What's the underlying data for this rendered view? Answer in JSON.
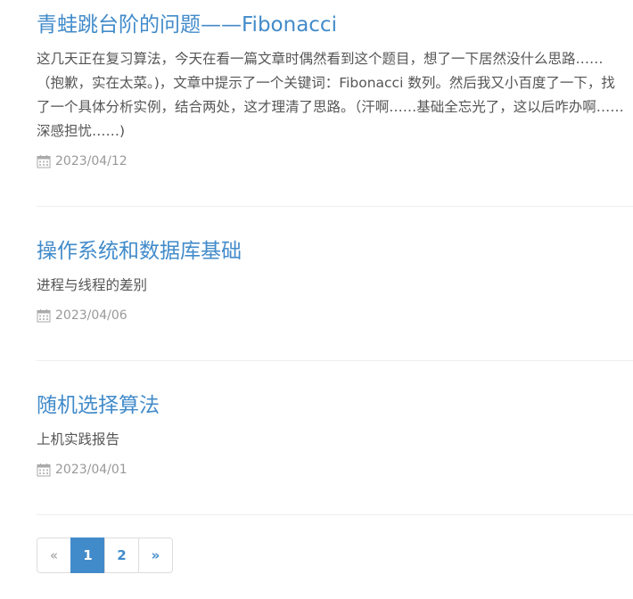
{
  "posts": [
    {
      "title": "青蛙跳台阶的问题——Fibonacci",
      "excerpt": "这几天正在复习算法，今天在看一篇文章时偶然看到这个题目，想了一下居然没什么思路……（抱歉，实在太菜。)，文章中提示了一个关键词：Fibonacci 数列。然后我又小百度了一下，找了一个具体分析实例，结合两处，这才理清了思路。（汗啊……基础全忘光了，这以后咋办啊……深感担忧……)",
      "date": "2023/04/12",
      "icon": "calendar-icon"
    },
    {
      "title": "操作系统和数据库基础",
      "excerpt": "进程与线程的差别",
      "date": "2023/04/06",
      "icon": "calendar-icon"
    },
    {
      "title": "随机选择算法",
      "excerpt": "上机实践报告",
      "date": "2023/04/01",
      "icon": "calendar-icon"
    }
  ],
  "pagination": {
    "prev": "«",
    "pages": [
      "1",
      "2"
    ],
    "current": "1",
    "next": "»"
  },
  "colors": {
    "link": "#428bca",
    "text": "#555555",
    "meta": "#999999",
    "divider": "#eeeeee"
  }
}
